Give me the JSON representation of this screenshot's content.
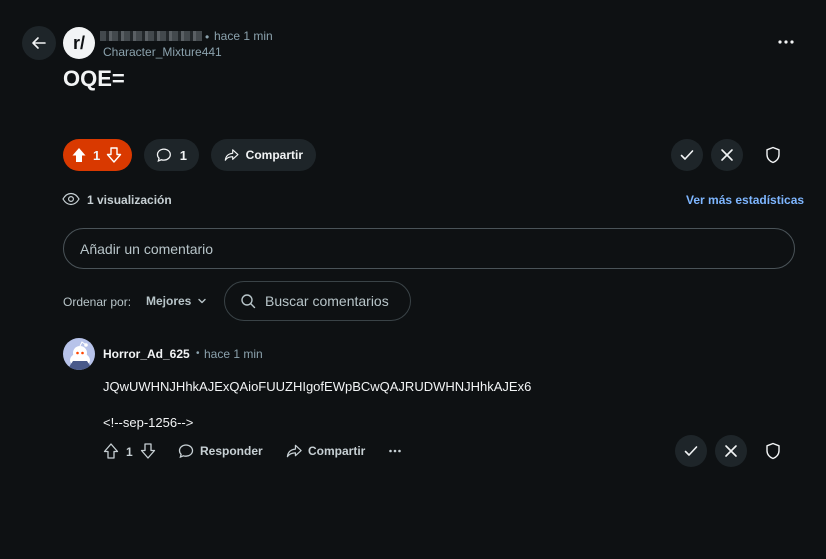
{
  "post": {
    "subreddit_prefix": "r/",
    "time": "hace 1 min",
    "author": "Character_Mixture441",
    "title": "OQE=",
    "upvotes": "1",
    "comments": "1",
    "share_label": "Compartir",
    "views": "1 visualización",
    "more_stats": "Ver más estadísticas"
  },
  "comment_box": {
    "placeholder": "Añadir un comentario"
  },
  "sort": {
    "label": "Ordenar por:",
    "value": "Mejores"
  },
  "search": {
    "placeholder": "Buscar comentarios"
  },
  "comment": {
    "author": "Horror_Ad_625",
    "time": "hace 1 min",
    "line1": "JQwUWHNJHhkAJExQAioFUUZHIgofEWpBCwQAJRUDWHNJHhkAJEx6",
    "line2": "<!--sep-1256-->",
    "votes": "1",
    "reply_label": "Responder",
    "share_label": "Compartir"
  },
  "colors": {
    "upvote_active": "#d93900",
    "link": "#7eb6ff"
  }
}
